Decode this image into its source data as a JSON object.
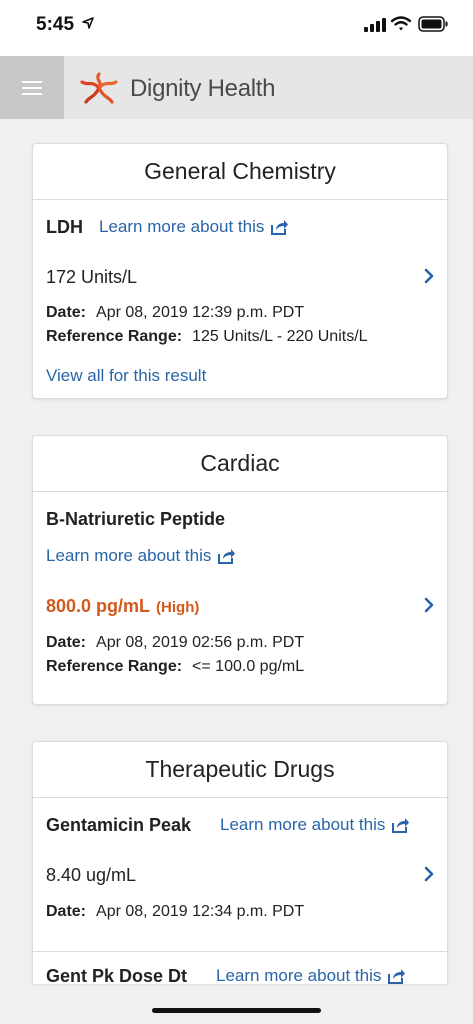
{
  "status": {
    "time": "5:45"
  },
  "header": {
    "brand": "Dignity Health"
  },
  "colors": {
    "link": "#2a64a8",
    "high": "#d35a1e",
    "header_bg": "#e6e6e6"
  },
  "cards": [
    {
      "title": "General Chemistry",
      "tests": [
        {
          "name": "LDH",
          "learn_more": "Learn more about this",
          "value": "172 Units/L",
          "date_label": "Date:",
          "date": "Apr 08, 2019 12:39 p.m. PDT",
          "range_label": "Reference Range:",
          "range": "125 Units/L - 220 Units/L",
          "view_all": "View all for this result"
        }
      ]
    },
    {
      "title": "Cardiac",
      "tests": [
        {
          "name": "B-Natriuretic Peptide",
          "learn_more": "Learn more about this",
          "value": "800.0 pg/mL",
          "flag": "(High)",
          "date_label": "Date:",
          "date": "Apr 08, 2019 02:56 p.m. PDT",
          "range_label": "Reference Range:",
          "range": "<= 100.0 pg/mL"
        }
      ]
    },
    {
      "title": "Therapeutic Drugs",
      "tests": [
        {
          "name": "Gentamicin Peak",
          "learn_more": "Learn more about this",
          "value": "8.40 ug/mL",
          "date_label": "Date:",
          "date": "Apr 08, 2019 12:34 p.m. PDT"
        },
        {
          "name": "Gent Pk Dose Dt",
          "learn_more": "Learn more about this"
        }
      ]
    }
  ]
}
